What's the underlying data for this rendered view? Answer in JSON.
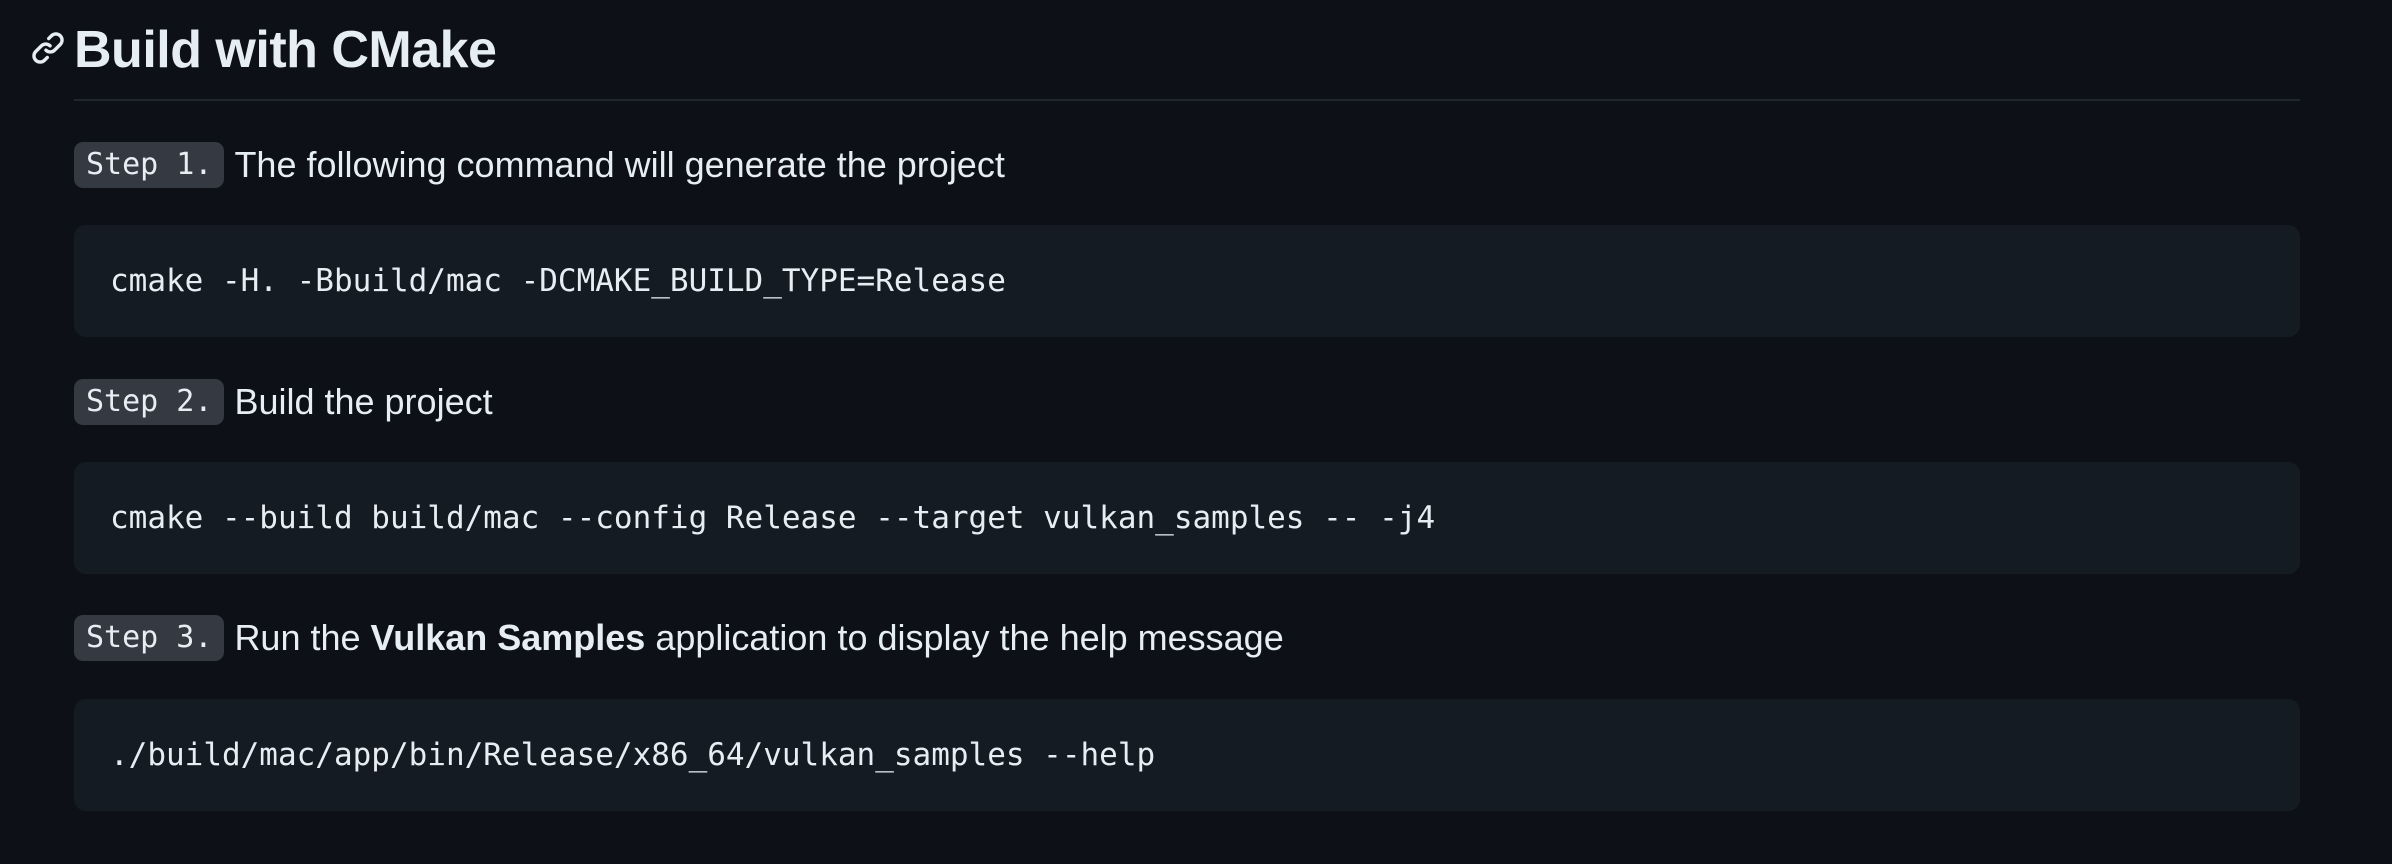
{
  "section": {
    "title": "Build with CMake",
    "anchor_icon": "link-icon"
  },
  "steps": [
    {
      "label": "Step 1.",
      "text": "The following command will generate the project",
      "command": "cmake -H. -Bbuild/mac -DCMAKE_BUILD_TYPE=Release"
    },
    {
      "label": "Step 2.",
      "text": "Build the project",
      "command": "cmake --build build/mac --config Release --target vulkan_samples -- -j4"
    },
    {
      "label": "Step 3.",
      "text_before": "Run the ",
      "text_strong": "Vulkan Samples",
      "text_after": " application to display the help message",
      "command": "./build/mac/app/bin/Release/x86_64/vulkan_samples --help"
    }
  ],
  "colors": {
    "background": "#0d1117",
    "text": "#e6edf3",
    "code_background": "#151b23",
    "badge_background": "#343942",
    "rule": "#21262d"
  }
}
